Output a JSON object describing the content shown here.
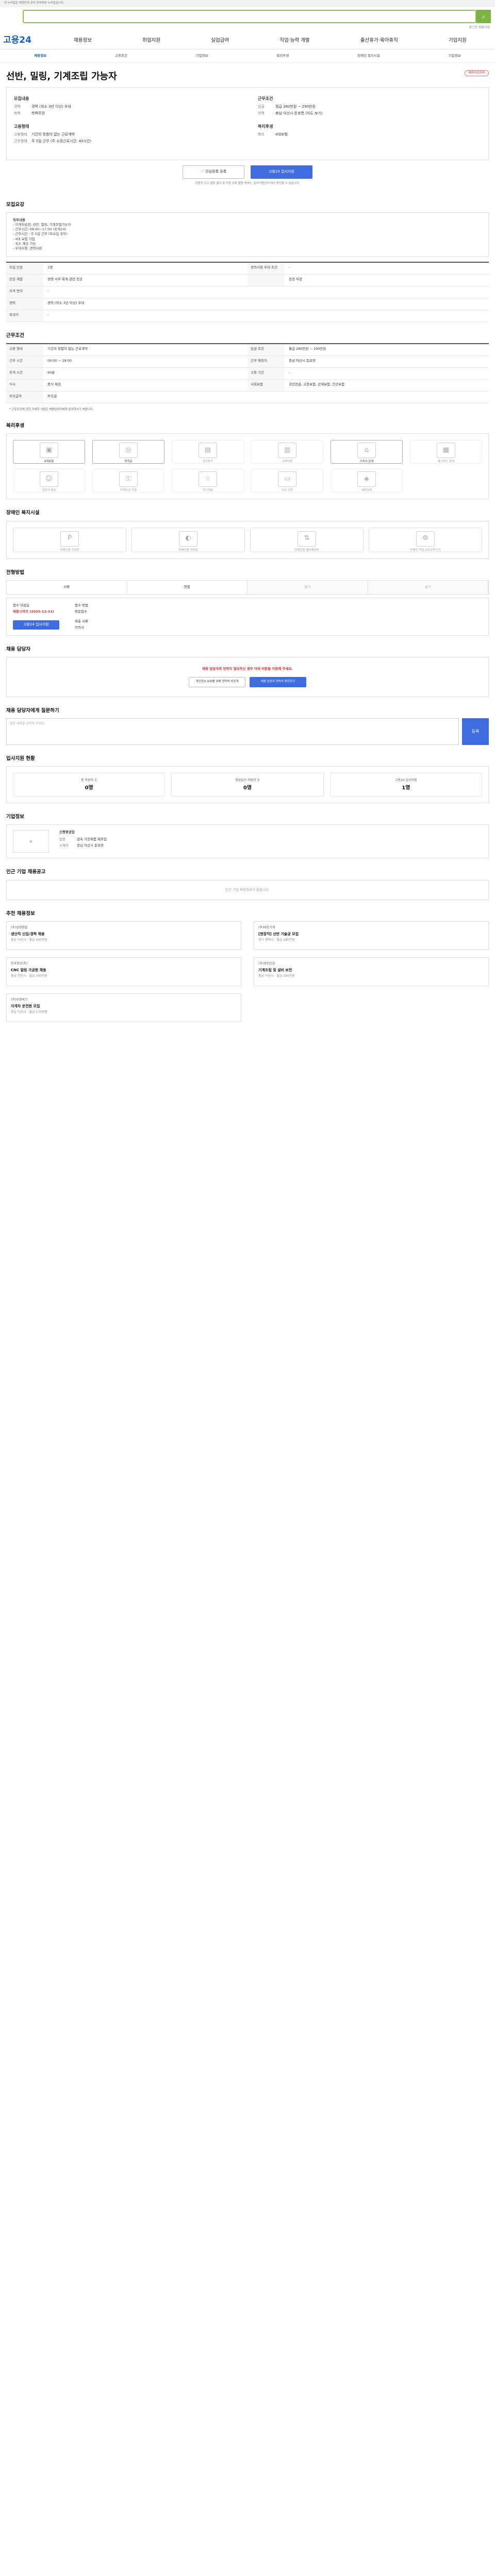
{
  "gov": "이 누리집은 대한민국 공식 전자정부 누리집입니다.",
  "util": "로그인 회원가입",
  "logo": "고용24",
  "gnb": [
    "채용정보",
    "취업지원",
    "실업급여",
    "직업·능력 개발",
    "출산휴가·육아휴직",
    "기업지원"
  ],
  "subnav": [
    "채용정보",
    "고용조건",
    "기업정보",
    "복리후생",
    "장애인 복지시설",
    "기업정보"
  ],
  "job": {
    "title": "선반, 밀링, 기계조립 가능자",
    "dday": "채용마감까지",
    "left_head": "모집내용",
    "right_head": "근무조건",
    "left": [
      [
        "경력",
        "경력 (최소 3년 이상) 우대"
      ],
      [
        "학력",
        "학력무관"
      ]
    ],
    "right": [
      [
        "임금",
        "월급 280만원 ~ 290만원"
      ],
      [
        "지역",
        "충남 아산시 둔포면 (지도 보기)"
      ]
    ],
    "left2_head": "고용형태",
    "right2_head": "복리후생",
    "left2": [
      [
        "고용형태",
        "기간의 정함이 없는 근로계약"
      ],
      [
        "근무형태",
        "주 5일 근무 (주 소정근로시간: 40시간)"
      ]
    ],
    "right2": [
      [
        "복리",
        "4대보험"
      ]
    ]
  },
  "apply": {
    "interest": "관심등록 등록",
    "apply": "고용24 입사지원",
    "note": "지원자 공고 열람 결과 및 지원 서류 열람 여부는 '입사지원관리'에서 확인할 수 있습니다."
  },
  "recruit": {
    "title": "모집요강",
    "box": [
      "직무내용",
      "- 지게차운전, 선반, 밀링, 기계조립가능자",
      "- 근무시간: 08:00~17:00 (휴게1H)",
      "- 근무시간 : 주 5일 근무 (토요일 휴무)",
      "- 4대 보험 가입",
      "- 숙소 제공 가능",
      "- 우대사항: 경력사원"
    ],
    "rows": [
      [
        "모집 인원",
        "1명",
        "경력사항 우대 조건",
        "-"
      ],
      [
        "전공 계열",
        "경영·사무·회계 관련 전공",
        "",
        "전공 무관"
      ],
      [
        "자격 면허",
        "-",
        "",
        ""
      ],
      [
        "경력",
        "경력 (최소 3년 이상) 우대",
        "",
        ""
      ],
      [
        "외국어",
        "-",
        "",
        ""
      ]
    ]
  },
  "cond": {
    "title": "근무조건",
    "rows": [
      [
        "고용 형태",
        "기간의 정함이 없는 근로계약",
        "임금 조건",
        "월급 280만원 ~ 290만원"
      ],
      [
        "근무 시간",
        "09:00 ~ 18:00",
        "근무 예정지",
        "충남 아산시 둔포면"
      ],
      [
        "휴게 시간",
        "60분",
        "고용 기간",
        "-"
      ],
      [
        "식사",
        "중식 제공",
        "사회보험",
        "국민연금, 고용보험, 산재보험, 건강보험"
      ],
      [
        "퇴직급여",
        "퇴직금",
        "",
        ""
      ]
    ],
    "note": "* 근로조건에 관한 자세한 사항은 채용담당자에게 문의하시기 바랍니다."
  },
  "welfare": {
    "title": "복리후생",
    "items": [
      "4대보험",
      "퇴직금",
      "경조휴가",
      "교육지원",
      "기숙사 운영",
      "통근버스 운영",
      "전문가 제공",
      "주택자금 지원",
      "자기계발",
      "이사 지원",
      "제휴업체"
    ]
  },
  "disable": {
    "title": "장애인 복지시설",
    "items": [
      "장애인용 주차장",
      "장애인용 화장실",
      "장애인용 엘리베이터",
      "장애인 작업 보조공학기기"
    ]
  },
  "steps": {
    "title": "전형방법",
    "items": [
      "서류",
      "면접",
      "필기",
      "실기"
    ]
  },
  "deadline": {
    "label": "접수 마감일",
    "value": "채용시까지 (2025-12-31)",
    "method_label": "접수 방법",
    "method": "방문접수",
    "docs_label": "제출 서류",
    "docs": "이력서"
  },
  "contact": {
    "title": "채용 담당자",
    "msg": "채용 담당자와 연락이 필요하신 경우 아래 버튼을 이용해 주세요.",
    "b1": "개인정보 보호를 위해 연락처 비공개",
    "b2": "채용 담당자 연락처 확인하기"
  },
  "qna": {
    "title": "채용 담당자에게 질문하기",
    "placeholder": "질문 내용을 입력해 주세요.",
    "btn": "등록"
  },
  "stats": {
    "title": "입사지원 현황",
    "items": [
      [
        "총 지원자 수",
        "0명"
      ],
      [
        "취업알선 지원자 수",
        "0명"
      ],
      [
        "고용24 입사지원",
        "1명"
      ]
    ]
  },
  "company": {
    "title": "기업정보",
    "name": "신평중공업",
    "rows": [
      [
        "업종",
        "금속 가공제품 제조업"
      ],
      [
        "소재지",
        "충남 아산시 둔포면"
      ]
    ]
  },
  "nearby": {
    "title": "인근 기업 채용공고",
    "empty": "인근 기업 채용정보가 없습니다."
  },
  "reco": {
    "title": "추천 채용정보",
    "cards": [
      [
        "(주)삼영정밀",
        "생산직 신입/경력 채용",
        "충남 아산시 · 월급 260만원"
      ],
      [
        "(주)대한기계",
        "[현장직] 선반 기술공 모집",
        "경기 평택시 · 월급 280만원"
      ],
      [
        "한국정공(주)",
        "CNC 밀링 가공원 채용",
        "충남 천안시 · 월급 300만원"
      ],
      [
        "(주)성진산업",
        "기계조립 및 설비 보전",
        "충남 아산시 · 월급 290만원"
      ],
      [
        "(주)우림테크",
        "지게차 운전원 모집",
        "충남 아산시 · 월급 270만원"
      ]
    ]
  }
}
